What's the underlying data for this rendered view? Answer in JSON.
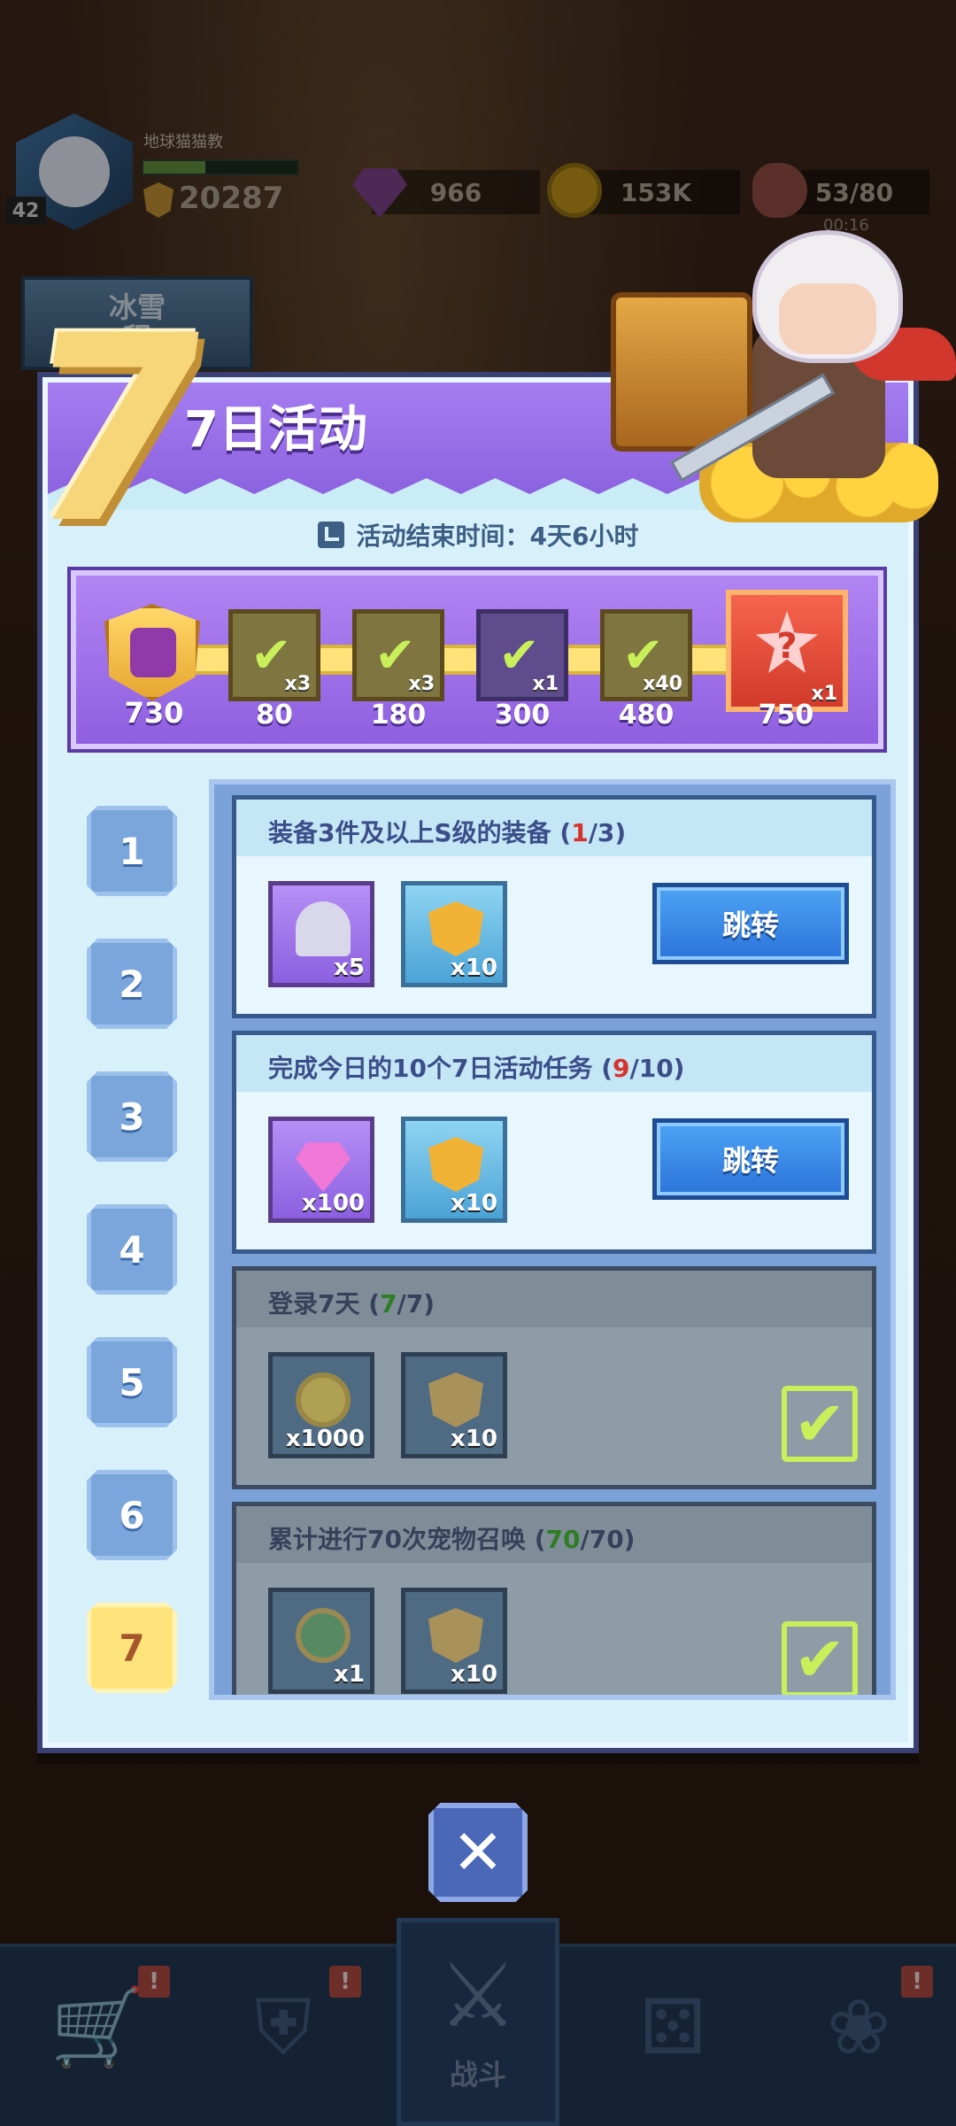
{
  "hud": {
    "level": "42",
    "player_name": "地球猫猫教",
    "power": "20287",
    "xp_progress": 0.4,
    "gems": "966",
    "coins": "153K",
    "stamina": "53/80",
    "stamina_timer": "00:16",
    "side_banner_line1": "冰雪",
    "side_banner_line2": "程"
  },
  "event": {
    "big_number": "7",
    "title": "7日活动",
    "end_time_text": "活动结束时间：4天6小时",
    "current_points": "730",
    "milestones": [
      {
        "points": "80",
        "qty": "x3",
        "icon": "check-icon",
        "claimed": true
      },
      {
        "points": "180",
        "qty": "x3",
        "icon": "check-icon",
        "claimed": true
      },
      {
        "points": "300",
        "qty": "x1",
        "icon": "check-icon",
        "claimed": true
      },
      {
        "points": "480",
        "qty": "x40",
        "icon": "check-icon",
        "claimed": true
      },
      {
        "points": "750",
        "qty": "x1",
        "icon": "mystery-star-icon",
        "claimed": false
      }
    ],
    "days": [
      "1",
      "2",
      "3",
      "4",
      "5",
      "6",
      "7"
    ],
    "active_day": "7"
  },
  "tasks": [
    {
      "title_prefix": "装备3件及以上S级的装备 (",
      "current": "1",
      "title_suffix": "/3)",
      "rewards": [
        {
          "icon": "key-icon",
          "qty": "x5"
        },
        {
          "icon": "badge-icon",
          "qty": "x10"
        }
      ],
      "button": "跳转",
      "completed": false
    },
    {
      "title_prefix": "完成今日的10个7日活动任务 (",
      "current": "9",
      "title_suffix": "/10)",
      "rewards": [
        {
          "icon": "gem-icon",
          "qty": "x100"
        },
        {
          "icon": "badge-icon",
          "qty": "x10"
        }
      ],
      "button": "跳转",
      "completed": false
    },
    {
      "title_prefix": "登录7天 (",
      "current": "7",
      "title_suffix": "/7)",
      "rewards": [
        {
          "icon": "coin-icon",
          "qty": "x1000"
        },
        {
          "icon": "badge-icon",
          "qty": "x10"
        }
      ],
      "completed": true
    },
    {
      "title_prefix": "累计进行70次宠物召唤 (",
      "current": "70",
      "title_suffix": "/70)",
      "rewards": [
        {
          "icon": "pet-egg-icon",
          "qty": "x1"
        },
        {
          "icon": "badge-icon",
          "qty": "x10"
        }
      ],
      "completed": true
    }
  ],
  "close_label": "✕",
  "nav": {
    "shop_icon": "cart-icon",
    "equip_icon": "armor-icon",
    "battle_icon": "crossed-swords-icon",
    "battle_label": "战斗",
    "dice_icon": "dice-icon",
    "pet_icon": "paw-icon",
    "badge_text": "!"
  }
}
